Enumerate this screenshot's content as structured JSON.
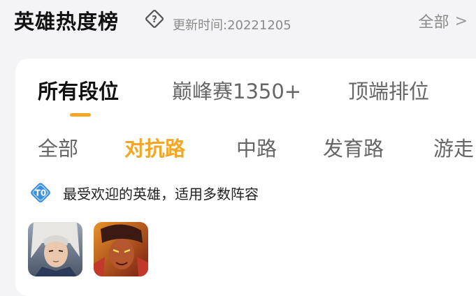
{
  "header": {
    "title": "英雄热度榜",
    "update_time": "更新时间:20221205",
    "all_label": "全部",
    "chevron": ">"
  },
  "rank_tabs": [
    {
      "label": "所有段位",
      "active": true
    },
    {
      "label": "巅峰赛1350+",
      "active": false
    },
    {
      "label": "顶端排位",
      "active": false
    }
  ],
  "lane_tabs": [
    {
      "label": "全部",
      "active": false
    },
    {
      "label": "对抗路",
      "active": true
    },
    {
      "label": "中路",
      "active": false
    },
    {
      "label": "发育路",
      "active": false
    },
    {
      "label": "游走",
      "active": false
    }
  ],
  "popular": {
    "badge_text": "T0",
    "text": "最受欢迎的英雄，适用多数阵容"
  },
  "heroes": [
    {
      "icon": "hero-portrait-white-hair"
    },
    {
      "icon": "hero-portrait-red-warrior"
    }
  ],
  "colors": {
    "accent": "#f5a623",
    "badge": "#3a8fe0",
    "muted": "#8a8a8a"
  }
}
